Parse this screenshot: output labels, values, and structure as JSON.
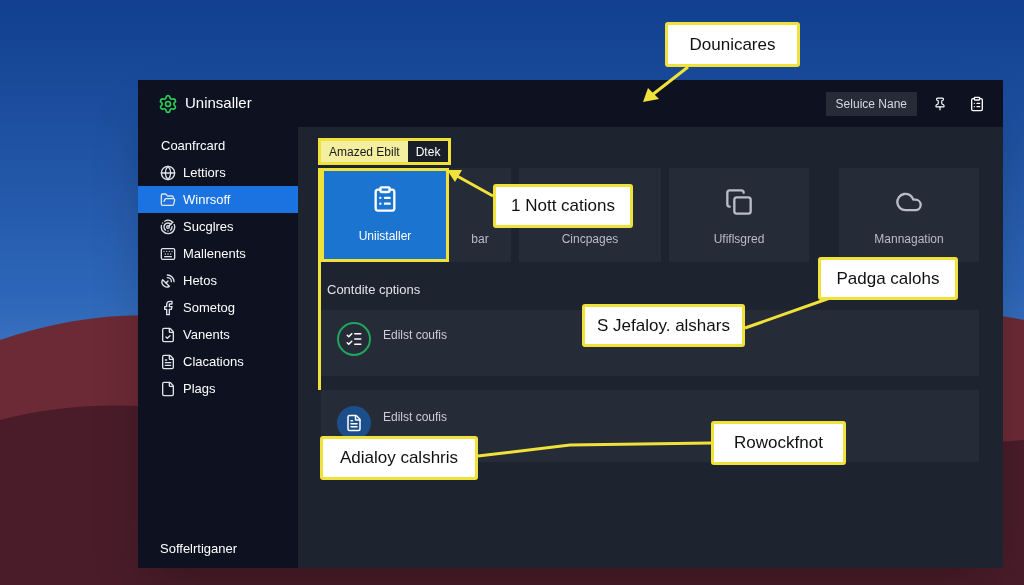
{
  "window": {
    "title": "Uninsaller",
    "search_button": "Seluice Nane"
  },
  "sidebar": {
    "heading": "Coanfrcard",
    "items": [
      {
        "label": "Lettiors",
        "selected": false
      },
      {
        "label": "Winrsoff",
        "selected": true
      },
      {
        "label": "Sucglres",
        "selected": false
      },
      {
        "label": "Mallenents",
        "selected": false
      },
      {
        "label": "Hetos",
        "selected": false
      },
      {
        "label": "Sometog",
        "selected": false
      },
      {
        "label": "Vanents",
        "selected": false
      },
      {
        "label": "Clacations",
        "selected": false
      },
      {
        "label": "Plags",
        "selected": false
      }
    ],
    "footer": "Soffelrtiganer"
  },
  "tabs": [
    {
      "label": "Amazed Ebilt",
      "selected": true
    },
    {
      "label": "Dtek",
      "selected": false
    }
  ],
  "tiles": [
    {
      "label": "Uniistaller",
      "selected": true
    },
    {
      "label": "bar",
      "selected": false
    },
    {
      "label": "Cincpages",
      "selected": false
    },
    {
      "label": "Ufiflsgred",
      "selected": false
    },
    {
      "label": "Mannagation",
      "selected": false
    }
  ],
  "section": {
    "title": "Contdite cptions",
    "rows": [
      {
        "label": "Edilst coufis"
      },
      {
        "label": "Edilst coufis"
      }
    ]
  },
  "callouts": [
    "Dounicares",
    "1 Nott cations",
    "Padga calohs",
    "S Jefaloy. alshars",
    "Adialoy calshris",
    "Rowockfnot"
  ]
}
